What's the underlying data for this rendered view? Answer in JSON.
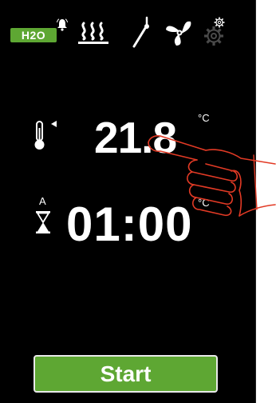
{
  "header": {
    "water_badge": "H2O",
    "icons": [
      "bell-icon",
      "heat-icon",
      "probe-icon",
      "fan-icon",
      "settings-gear-icon"
    ]
  },
  "temperature": {
    "value": "21.8",
    "unit": "°C"
  },
  "timer": {
    "mode": "A",
    "value": "01:00",
    "unit": "°C"
  },
  "actions": {
    "start_label": "Start"
  },
  "colors": {
    "accent": "#5ea733",
    "background": "#000000",
    "text": "#ffffff",
    "hand_outline": "#e23a25"
  }
}
